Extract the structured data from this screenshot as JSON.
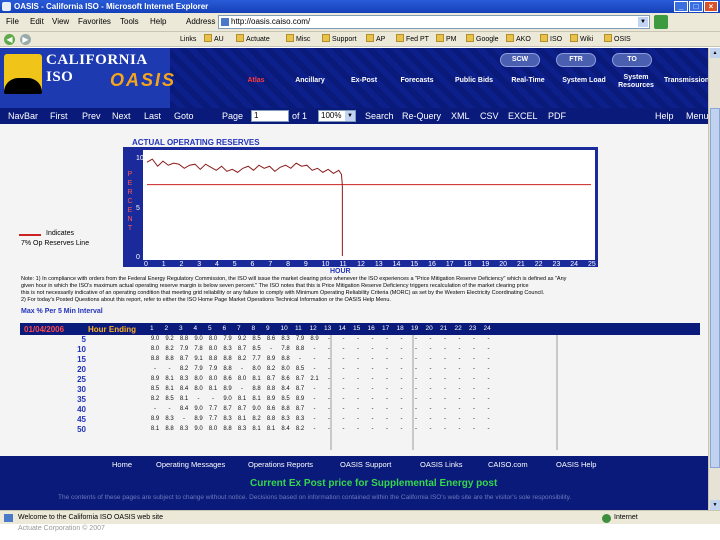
{
  "window": {
    "title": "OASIS - California ISO - Microsoft Internet Explorer",
    "controls": [
      "_",
      "□",
      "×"
    ]
  },
  "menu": {
    "items": [
      "File",
      "Edit",
      "View",
      "Favorites",
      "Tools",
      "Help"
    ],
    "address_label": "Address",
    "address_value": "http://oasis.caiso.com/"
  },
  "links_toolbar": {
    "items": [
      "Links",
      "AU",
      "Actuate",
      "Misc",
      "Support",
      "AP",
      "Fed PT",
      "PM",
      "Google",
      "AKO",
      "ISO",
      "Wiki",
      "OSIS"
    ]
  },
  "header": {
    "brand_top": "CALIFORNIA ISO",
    "brand_bottom": "OASIS",
    "oval_buttons": [
      "SCW",
      "FTR",
      "TO"
    ],
    "tabs": [
      {
        "label": "Atlas",
        "active": true
      },
      {
        "label": "Ancillary",
        "active": false
      },
      {
        "label": "Ex-Post",
        "active": false
      },
      {
        "label": "Forecasts",
        "active": false
      },
      {
        "label": "Public Bids",
        "active": false
      },
      {
        "label": "Real-Time",
        "active": false
      },
      {
        "label": "System Load",
        "active": false
      },
      {
        "label": "System Resources",
        "active": false
      },
      {
        "label": "Transmission",
        "active": false
      }
    ]
  },
  "pager": {
    "navbar": "NavBar",
    "first": "First",
    "prev": "Prev",
    "next": "Next",
    "last": "Last",
    "goto": "Goto",
    "page_label": "Page",
    "page_value": "1",
    "of_label": "of 1",
    "zoom_value": "100%",
    "search": "Search",
    "requery": "Re-Query",
    "xml": "XML",
    "csv": "CSV",
    "excel": "EXCEL",
    "pdf": "PDF",
    "help": "Help",
    "menu": "Menu"
  },
  "report": {
    "chart_title": "ACTUAL OPERATING RESERVES",
    "legend_label_1": "Indicates",
    "legend_label_2": "7% Op Reserves Line",
    "note_lines": [
      "Note: 1) In compliance with orders from the Federal Energy Regulatory Commission, the ISO will issue the market clearing price whenever the ISO experiences a \"Price Mitigation Reserve Deficiency\" which is defined as \"Any",
      "        given hour in which the ISO's maximum actual operating reserve margin is below seven percent.\" The ISO notes that this is Price Mitigation Reserve Deficiency triggers recalculation of the market clearing price",
      "        this is not necessarily indicative of an operating condition that meeting grid reliability or any failure to comply with Minimum Operating Reliability Criteria (MORC) as set by the Western Electricity Coordinating Council.",
      "        2) For today's Posted Questions about this report, refer to either the ISO Home Page Market Operations Technical Information or the OASIS Help Menu."
    ],
    "interval_label": "Max % Per 5 Min Interval",
    "date": "01/04/2006",
    "hour_ending_label": "Hour Ending"
  },
  "chart_data": {
    "type": "line",
    "title": "ACTUAL OPERATING RESERVES",
    "xlabel": "HOUR",
    "ylabel": "PERCENT",
    "x_ticks": [
      "0",
      "1",
      "2",
      "3",
      "4",
      "5",
      "6",
      "7",
      "8",
      "9",
      "10",
      "11",
      "12",
      "13",
      "14",
      "15",
      "16",
      "17",
      "18",
      "19",
      "20",
      "21",
      "22",
      "23",
      "24",
      "25"
    ],
    "y_ticks": [
      "10",
      "5",
      "0"
    ],
    "ylim": [
      0,
      10
    ],
    "xlim": [
      0,
      25
    ],
    "series": [
      {
        "values_x": [
          0.0,
          0.3,
          0.6,
          0.9,
          1.2,
          1.5,
          1.8,
          2.1,
          2.4,
          2.7,
          3.0,
          3.3,
          3.6,
          3.9,
          4.2,
          4.5,
          4.8,
          5.1,
          5.4,
          5.7,
          6.0,
          6.3,
          6.6,
          6.9,
          7.2,
          7.5,
          7.8,
          8.1,
          8.4,
          8.7,
          9.0,
          9.3,
          9.6,
          9.9,
          10.2,
          10.5,
          10.8,
          10.95,
          11.0
        ],
        "values": [
          9.2,
          9.5,
          8.8,
          9.3,
          8.9,
          9.1,
          9.0,
          8.6,
          8.9,
          9.0,
          8.5,
          9.0,
          8.7,
          8.4,
          8.8,
          8.3,
          8.5,
          8.2,
          8.6,
          8.8,
          8.4,
          8.9,
          8.6,
          8.8,
          8.3,
          8.7,
          8.9,
          8.6,
          9.1,
          8.8,
          8.9,
          8.4,
          8.6,
          8.2,
          8.5,
          8.1,
          8.4,
          8.0,
          6.9
        ]
      }
    ],
    "threshold": 7,
    "grid": false,
    "legend": "left"
  },
  "table": {
    "columns": [
      "1",
      "2",
      "3",
      "4",
      "5",
      "6",
      "7",
      "8",
      "9",
      "10",
      "11",
      "12",
      "13",
      "14",
      "15",
      "16",
      "17",
      "18",
      "19",
      "20",
      "21",
      "22",
      "23",
      "24"
    ],
    "rows": [
      {
        "min": "5",
        "vals": [
          "9.0",
          "9.2",
          "8.8",
          "9.0",
          "8.0",
          "7.9",
          "9.2",
          "8.5",
          "8.6",
          "8.3",
          "7.9",
          "8.9",
          "-",
          "-",
          "-",
          "-",
          "-",
          "-",
          "-",
          "-",
          "-",
          "-",
          "-",
          "-"
        ]
      },
      {
        "min": "10",
        "vals": [
          "8.0",
          "8.2",
          "7.9",
          "7.8",
          "8.0",
          "8.3",
          "8.7",
          "8.5",
          "-",
          "7.8",
          "8.8",
          "-",
          "-",
          "-",
          "-",
          "-",
          "-",
          "-",
          "-",
          "-",
          "-",
          "-",
          "-",
          "-"
        ]
      },
      {
        "min": "15",
        "vals": [
          "8.8",
          "8.8",
          "8.7",
          "9.1",
          "8.8",
          "8.8",
          "8.2",
          "7.7",
          "8.9",
          "8.8",
          "-",
          "-",
          "-",
          "-",
          "-",
          "-",
          "-",
          "-",
          "-",
          "-",
          "-",
          "-",
          "-",
          "-"
        ]
      },
      {
        "min": "20",
        "vals": [
          "-",
          "-",
          "8.2",
          "7.9",
          "7.9",
          "8.8",
          "-",
          "8.0",
          "8.2",
          "8.0",
          "8.5",
          "-",
          "-",
          "-",
          "-",
          "-",
          "-",
          "-",
          "-",
          "-",
          "-",
          "-",
          "-",
          "-"
        ]
      },
      {
        "min": "25",
        "vals": [
          "8.9",
          "8.1",
          "8.3",
          "8.0",
          "8.0",
          "8.6",
          "8.0",
          "8.1",
          "8.7",
          "8.6",
          "8.7",
          "2.1",
          "-",
          "-",
          "-",
          "-",
          "-",
          "-",
          "-",
          "-",
          "-",
          "-",
          "-",
          "-"
        ]
      },
      {
        "min": "30",
        "vals": [
          "8.5",
          "8.1",
          "8.4",
          "8.0",
          "8.1",
          "8.9",
          "-",
          "8.8",
          "8.8",
          "8.4",
          "8.7",
          "-",
          "-",
          "-",
          "-",
          "-",
          "-",
          "-",
          "-",
          "-",
          "-",
          "-",
          "-",
          "-"
        ]
      },
      {
        "min": "35",
        "vals": [
          "8.2",
          "8.5",
          "8.1",
          "-",
          "-",
          "9.0",
          "8.1",
          "8.1",
          "8.9",
          "8.5",
          "8.9",
          "-",
          "-",
          "-",
          "-",
          "-",
          "-",
          "-",
          "-",
          "-",
          "-",
          "-",
          "-",
          "-"
        ]
      },
      {
        "min": "40",
        "vals": [
          "-",
          "-",
          "8.4",
          "9.0",
          "7.7",
          "8.7",
          "8.7",
          "9.0",
          "8.6",
          "8.8",
          "8.7",
          "-",
          "-",
          "-",
          "-",
          "-",
          "-",
          "-",
          "-",
          "-",
          "-",
          "-",
          "-",
          "-"
        ]
      },
      {
        "min": "45",
        "vals": [
          "8.9",
          "8.3",
          "-",
          "8.9",
          "7.7",
          "8.3",
          "8.1",
          "8.2",
          "8.8",
          "8.3",
          "8.3",
          "-",
          "-",
          "-",
          "-",
          "-",
          "-",
          "-",
          "-",
          "-",
          "-",
          "-",
          "-",
          "-"
        ]
      },
      {
        "min": "50",
        "vals": [
          "8.1",
          "8.8",
          "8.3",
          "9.0",
          "8.0",
          "8.8",
          "8.3",
          "8.1",
          "8.1",
          "8.4",
          "8.2",
          "-",
          "-",
          "-",
          "-",
          "-",
          "-",
          "-",
          "-",
          "-",
          "-",
          "-",
          "-",
          "-"
        ]
      }
    ]
  },
  "footer": {
    "links": [
      "Home",
      "Operating Messages",
      "Operations Reports",
      "OASIS Support",
      "OASIS Links",
      "CAISO.com",
      "OASIS Help"
    ],
    "banner": "Current Ex Post price for Supplemental Energy post",
    "disclaimer": "The contents of these pages are subject to change without notice. Decisions based on information contained within the California ISO's web site are the visitor's sole responsibility.",
    "welcome": "Welcome to the California ISO OASIS web site"
  },
  "status": {
    "text": "Done",
    "zone": "Internet",
    "copyright": "Actuate Corporation © 2007"
  },
  "colors": {
    "header_bg": "#0a1a7a",
    "chart_line": "#8b1a1a",
    "threshold_line": "#cc2222",
    "banner_text": "#34d84a",
    "active_tab": "#ff3a3a"
  }
}
